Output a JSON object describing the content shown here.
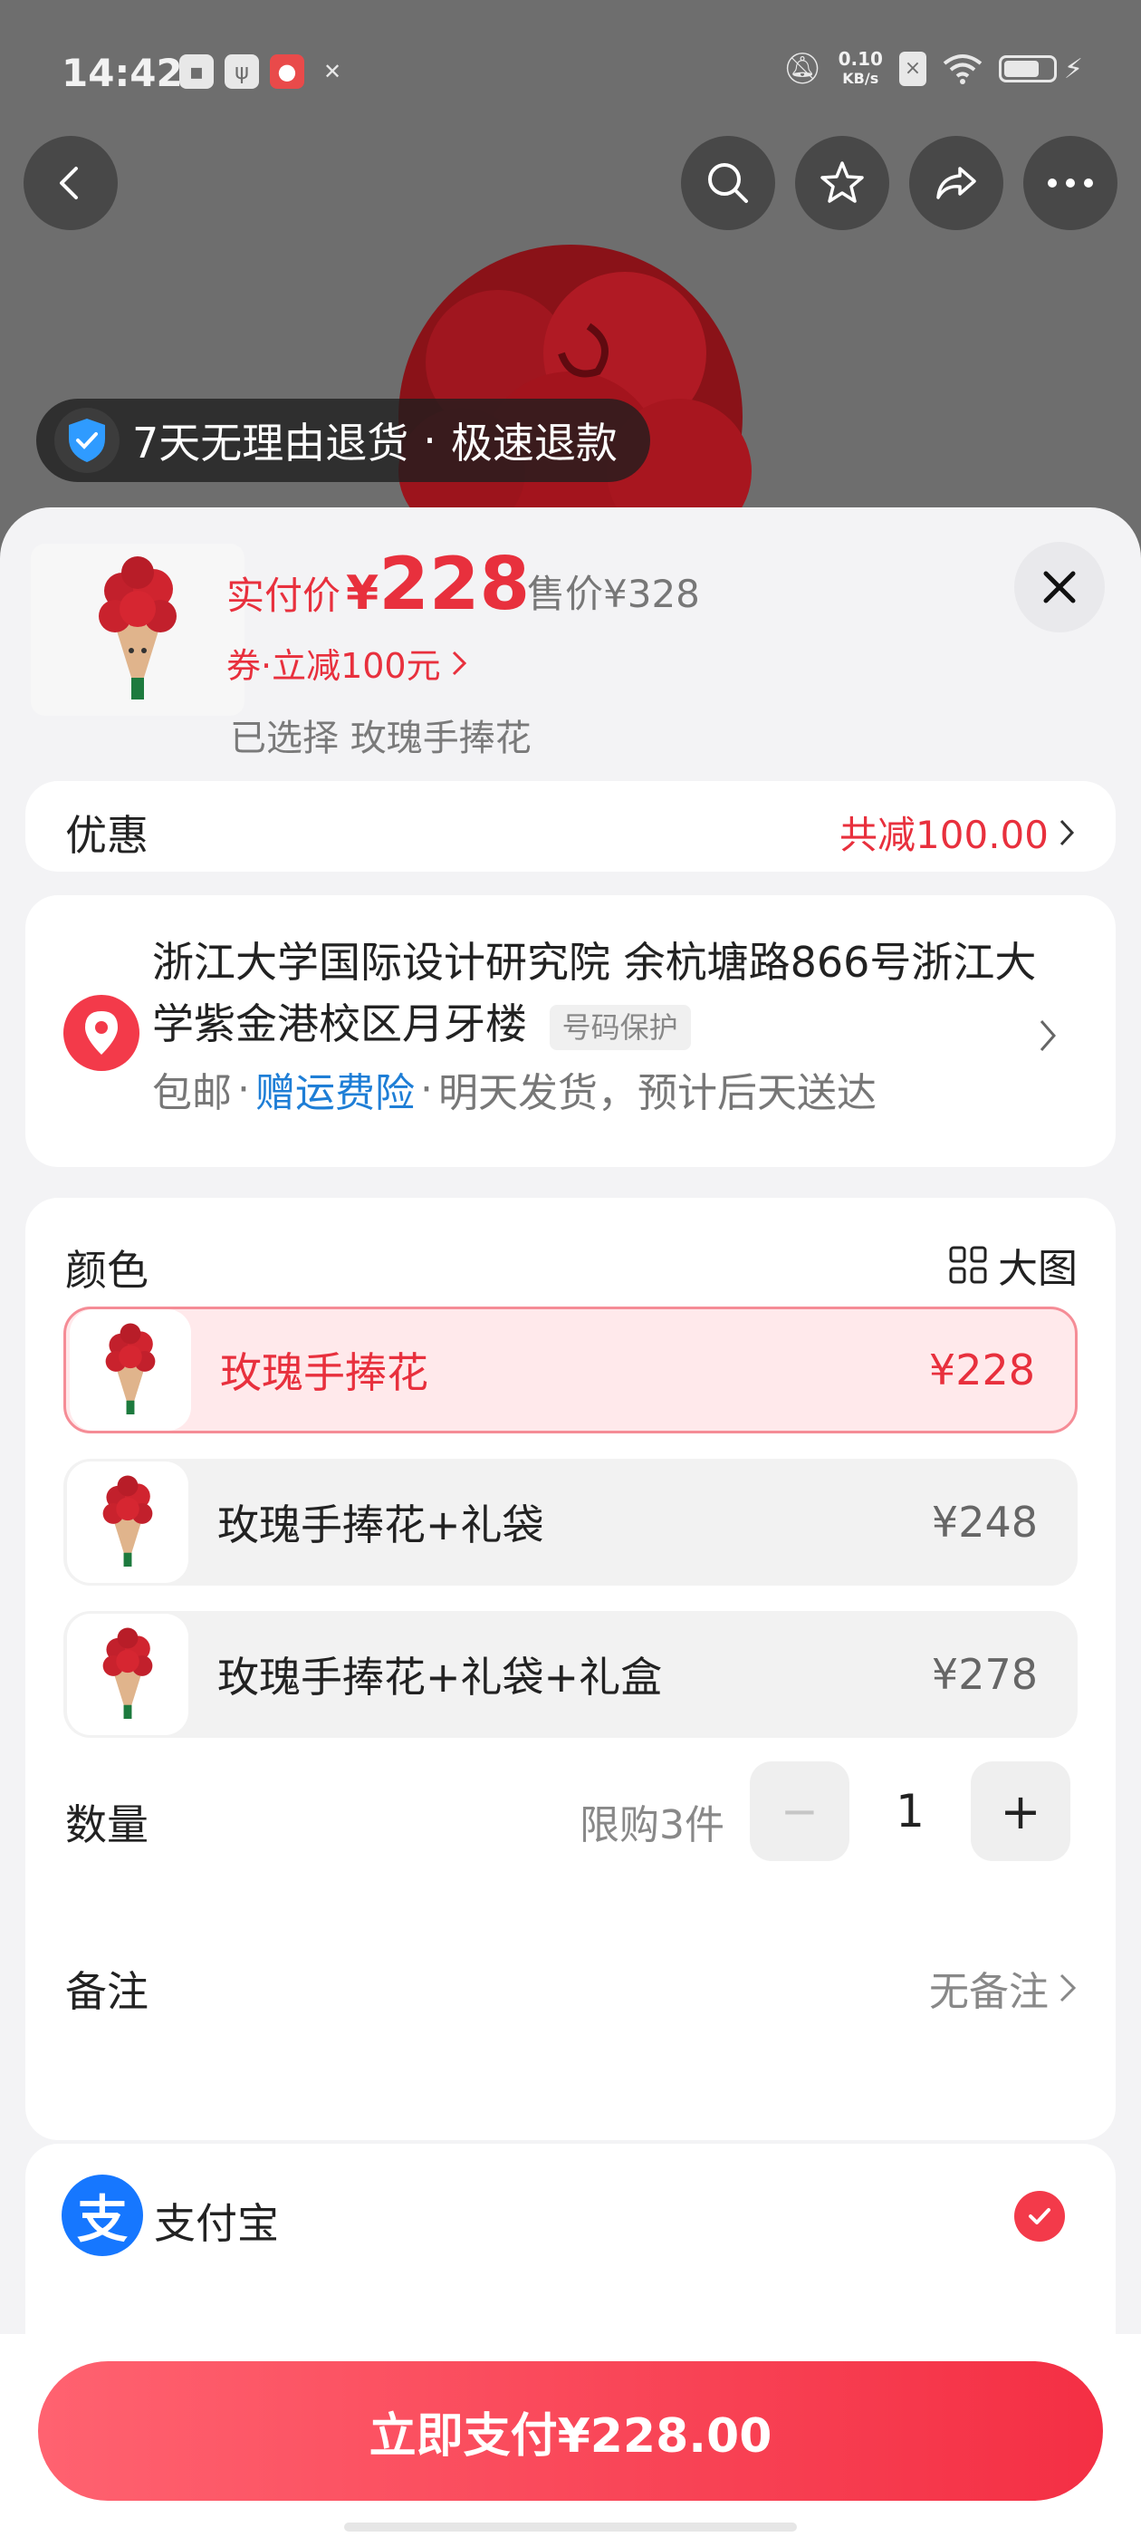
{
  "status_bar": {
    "time": "14:42",
    "net_speed_value": "0.10",
    "net_speed_unit": "KB/s",
    "icons": [
      "message-icon",
      "usb-icon",
      "app-icon",
      "tools-icon",
      "mute-icon",
      "sim-icon",
      "wifi-icon",
      "battery-icon"
    ]
  },
  "top_nav": {
    "icons": [
      "back-icon",
      "search-icon",
      "star-icon",
      "share-icon",
      "more-icon"
    ]
  },
  "guarantee": {
    "text1": "7天无理由退货",
    "sep": "·",
    "text2": "极速退款"
  },
  "product": {
    "pay_label": "实付价",
    "currency": "¥",
    "pay_price": "228",
    "orig_price": "售价¥328",
    "coupon": "券·立减100元",
    "selected": "已选择 玫瑰手捧花"
  },
  "discount": {
    "label": "优惠",
    "amount": "共减100.00"
  },
  "address": {
    "line": "浙江大学国际设计研究院 余杭塘路866号浙江大学紫金港校区月牙楼",
    "privacy": "号码保护",
    "free_shipping": "包邮",
    "dot": "·",
    "insurance": "赠运费险",
    "delivery": "明天发货，预计后天送达"
  },
  "options": {
    "color_label": "颜色",
    "big_image": "大图",
    "items": [
      {
        "name": "玫瑰手捧花",
        "price": "¥228",
        "selected": true
      },
      {
        "name": "玫瑰手捧花+礼袋",
        "price": "¥248",
        "selected": false
      },
      {
        "name": "玫瑰手捧花+礼袋+礼盒",
        "price": "¥278",
        "selected": false
      }
    ]
  },
  "quantity": {
    "label": "数量",
    "limit": "限购3件",
    "minus": "−",
    "value": "1",
    "plus": "+"
  },
  "note": {
    "label": "备注",
    "value": "无备注"
  },
  "payment": {
    "method": "支付宝",
    "alipay_glyph": "支"
  },
  "pay_button": {
    "label": "立即支付¥228.00"
  },
  "colors": {
    "accent": "#e8303d",
    "link_blue": "#1e7ed6",
    "alipay": "#1677ff"
  }
}
